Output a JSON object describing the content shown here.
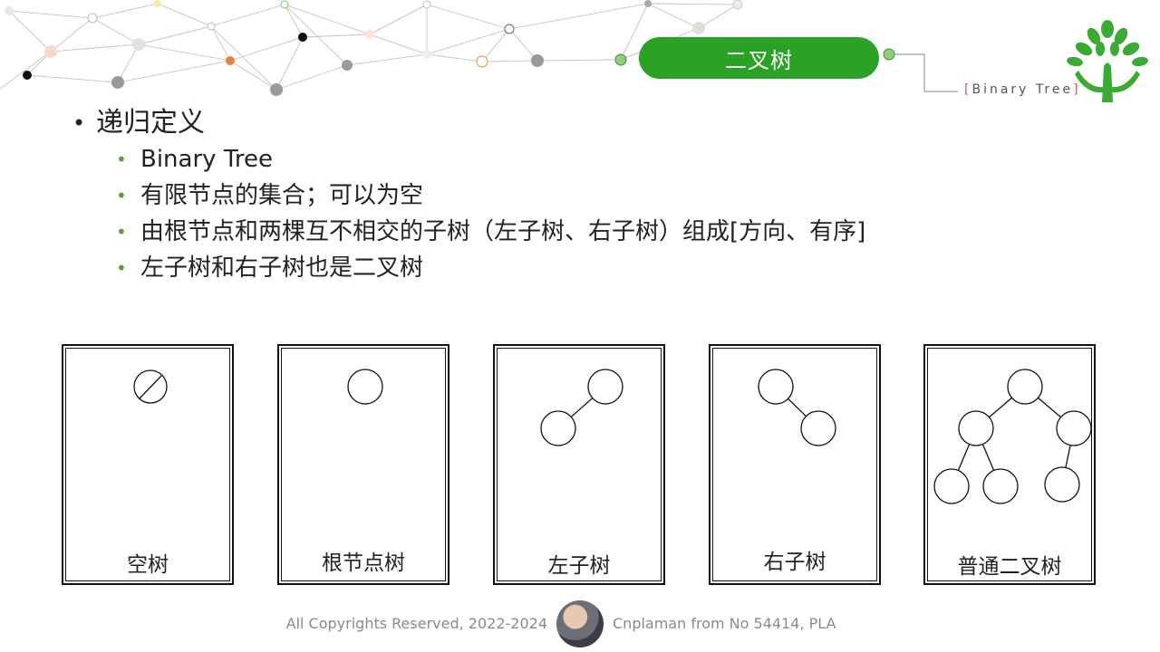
{
  "header": {
    "title": "二叉树",
    "subtitle": "Binary Tree",
    "accent_color": "#2aa226",
    "logo_icon": "tree-logo-icon"
  },
  "content": {
    "heading": "递归定义",
    "items": [
      "Binary Tree",
      "有限节点的集合；可以为空",
      "由根节点和两棵互不相交的子树（左子树、右子树）组成[方向、有序]",
      "左子树和右子树也是二叉树"
    ]
  },
  "diagrams": [
    {
      "label": "空树"
    },
    {
      "label": "根节点树"
    },
    {
      "label": "左子树"
    },
    {
      "label": "右子树"
    },
    {
      "label": "普通二叉树"
    }
  ],
  "footer": {
    "copyright": "All Copyrights Reserved, 2022-2024",
    "author": "Cnplaman from No 54414, PLA"
  }
}
